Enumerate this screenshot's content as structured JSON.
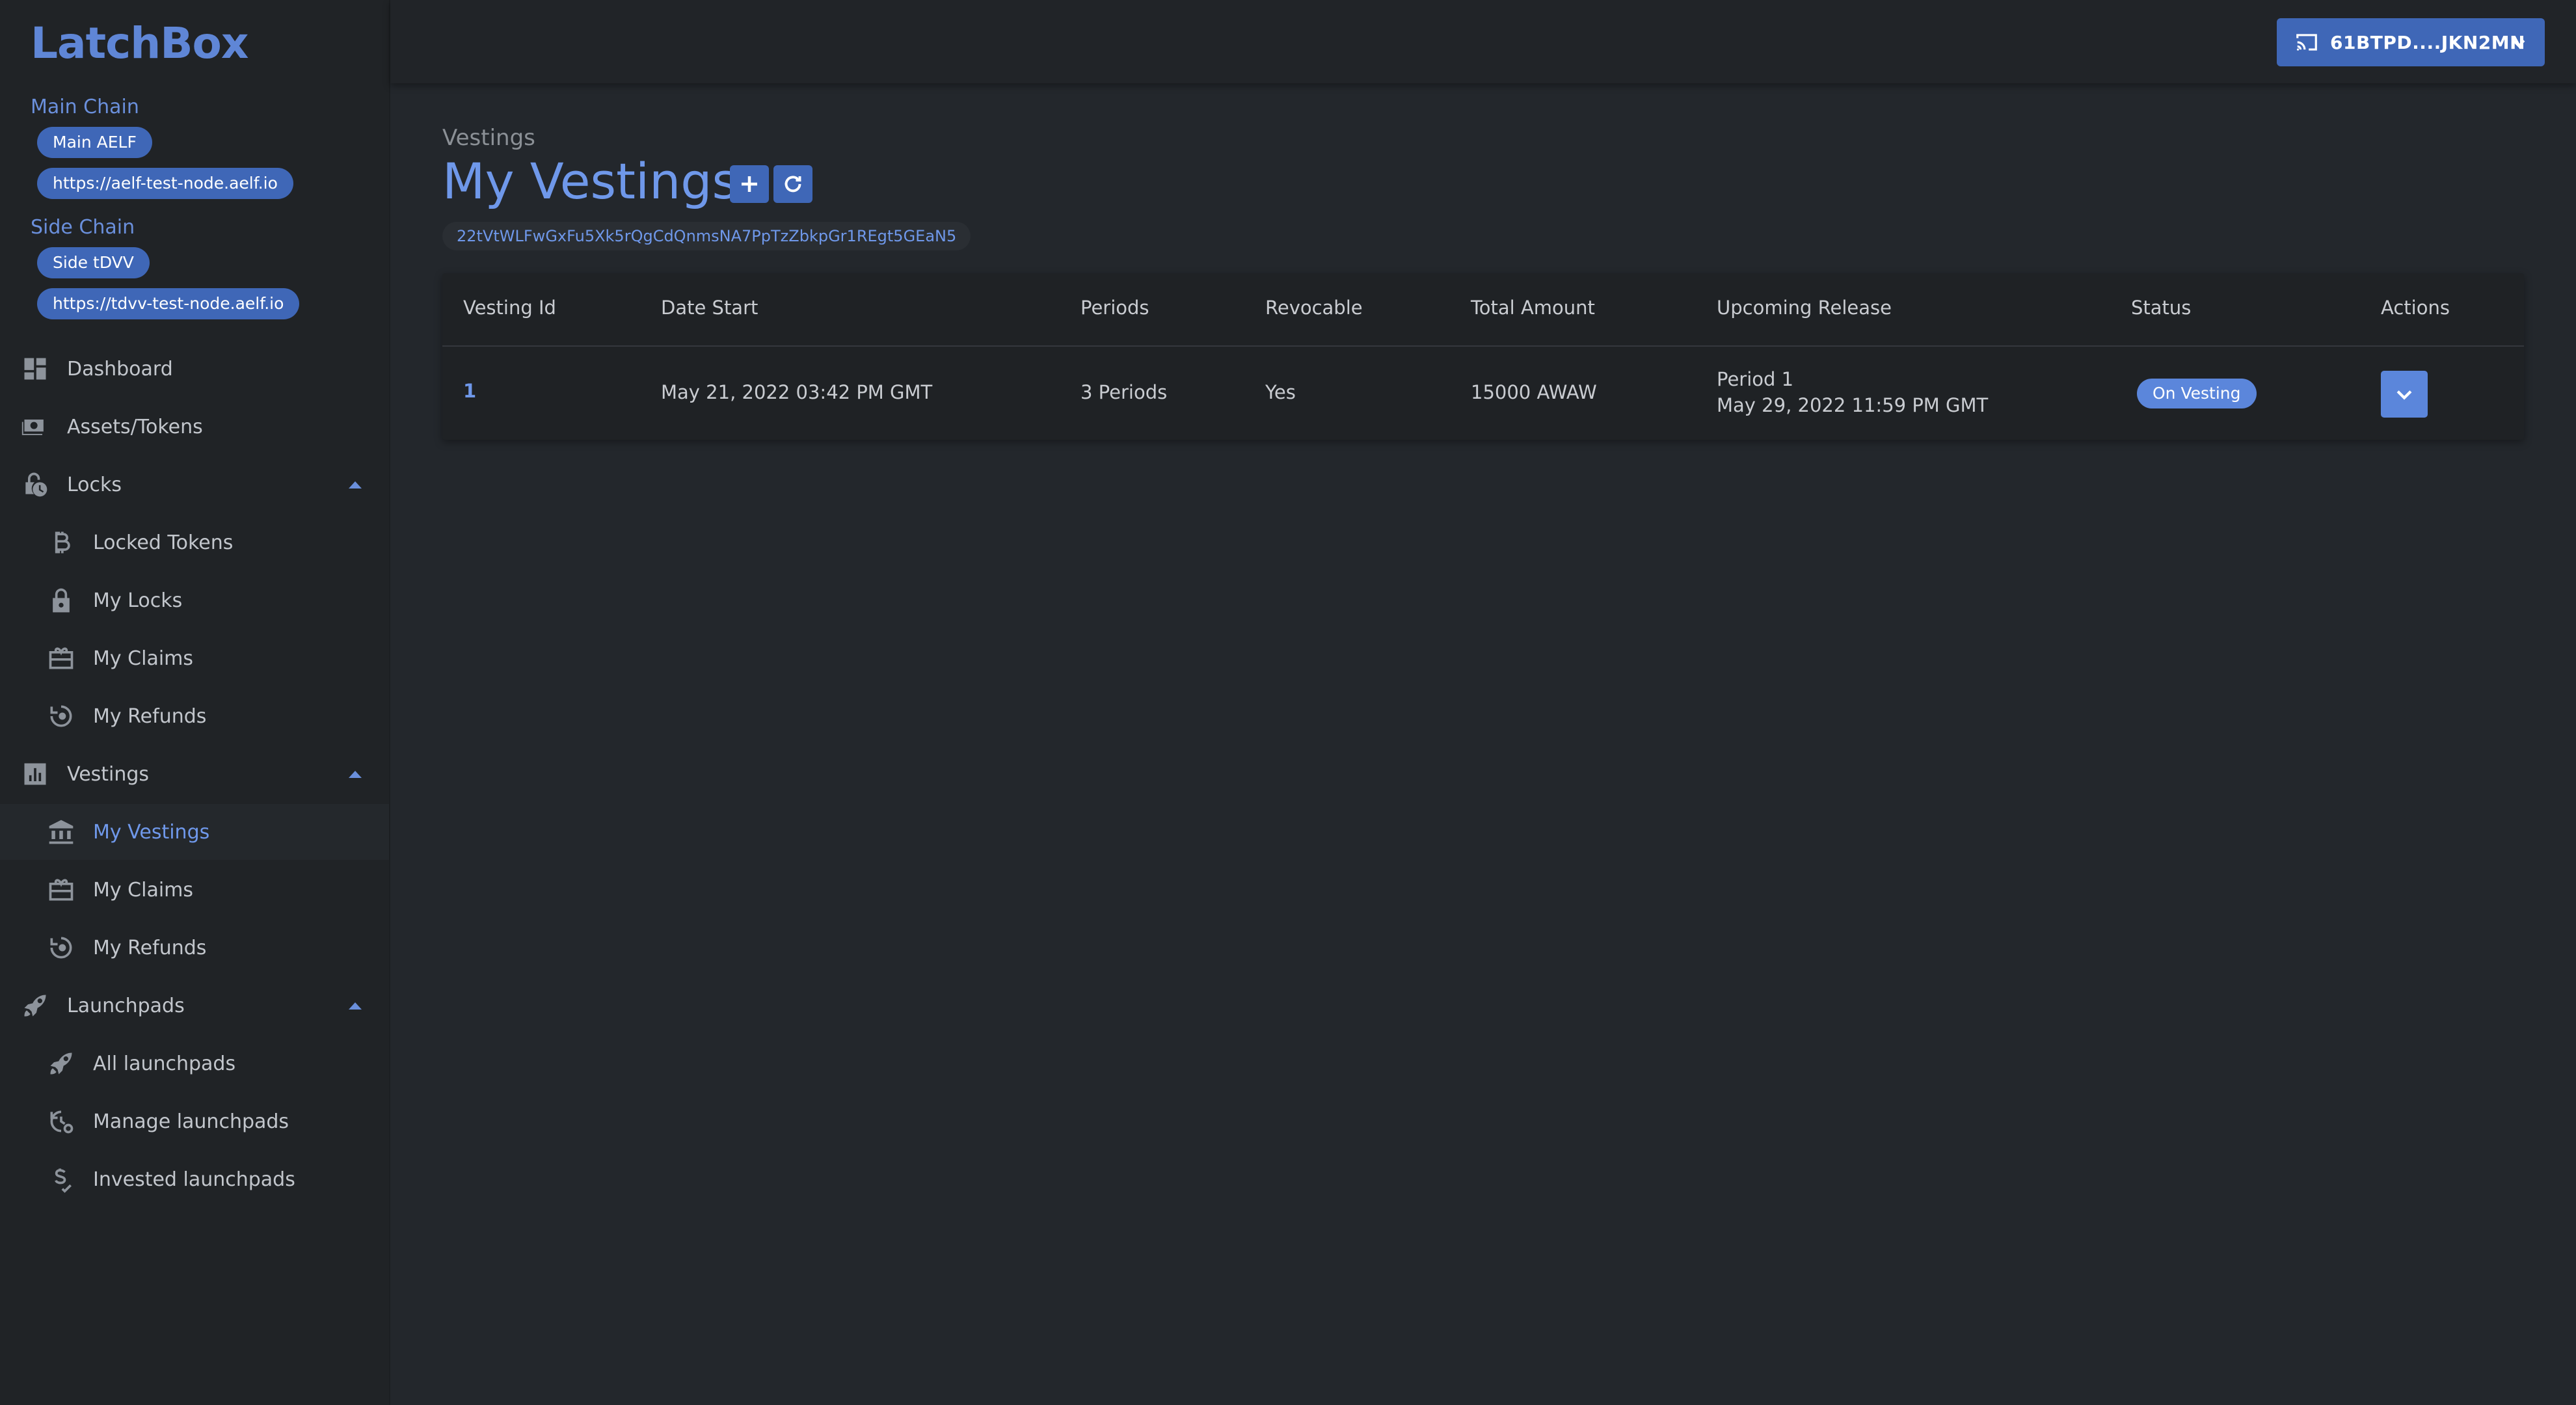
{
  "app": {
    "logo": "LatchBox"
  },
  "sidebar": {
    "main_chain": {
      "label": "Main Chain",
      "name": "Main AELF",
      "url": "https://aelf-test-node.aelf.io"
    },
    "side_chain": {
      "label": "Side Chain",
      "name": "Side tDVV",
      "url": "https://tdvv-test-node.aelf.io"
    },
    "items": [
      {
        "label": "Dashboard",
        "icon": "dashboard-icon"
      },
      {
        "label": "Assets/Tokens",
        "icon": "cash-icon"
      },
      {
        "label": "Locks",
        "icon": "lock-clock-icon",
        "expanded": true
      },
      {
        "label": "Locked Tokens",
        "icon": "bitcoin-icon"
      },
      {
        "label": "My Locks",
        "icon": "padlock-icon"
      },
      {
        "label": "My Claims",
        "icon": "gift-card-icon"
      },
      {
        "label": "My Refunds",
        "icon": "refund-icon"
      },
      {
        "label": "Vestings",
        "icon": "bar-chart-icon",
        "expanded": true
      },
      {
        "label": "My Vestings",
        "icon": "bank-icon",
        "active": true
      },
      {
        "label": "My Claims",
        "icon": "gift-card-icon"
      },
      {
        "label": "My Refunds",
        "icon": "refund-icon"
      },
      {
        "label": "Launchpads",
        "icon": "rocket-icon",
        "expanded": true
      },
      {
        "label": "All launchpads",
        "icon": "rocket-icon"
      },
      {
        "label": "Manage launchpads",
        "icon": "clock-settings-icon"
      },
      {
        "label": "Invested launchpads",
        "icon": "dollar-icon"
      }
    ]
  },
  "topbar": {
    "wallet_address": "61BTPD....JKN2MN"
  },
  "main": {
    "breadcrumb": "Vestings",
    "title": "My Vestings",
    "address": "22tVtWLFwGxFu5Xk5rQgCdQnmsNA7PpTzZbkpGr1REgt5GEaN5",
    "table": {
      "headers": [
        "Vesting Id",
        "Date Start",
        "Periods",
        "Revocable",
        "Total Amount",
        "Upcoming Release",
        "Status",
        "Actions"
      ],
      "rows": [
        {
          "id": "1",
          "date_start": "May 21, 2022 03:42 PM GMT",
          "periods": "3 Periods",
          "revocable": "Yes",
          "total_amount": "15000 AWAW",
          "release_period": "Period 1",
          "release_date": "May 29, 2022 11:59 PM GMT",
          "status": "On Vesting"
        }
      ]
    }
  },
  "colors": {
    "accent": "#3f67b7",
    "link": "#6f98ea",
    "background": "#23272c",
    "sidebar": "#202326"
  }
}
